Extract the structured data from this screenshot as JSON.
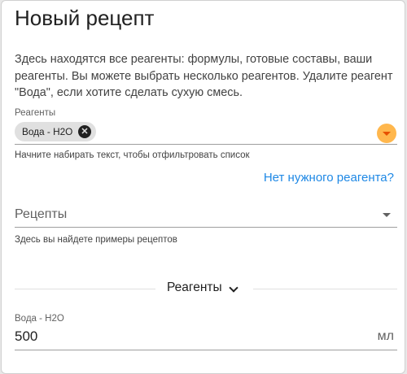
{
  "page": {
    "title": "Новый рецепт",
    "description": "Здесь находятся все реагенты: формулы, готовые составы, ваши реагенты. Вы можете выбрать несколько реагентов. Удалите реагент \"Вода\", если хотите сделать сухую смесь."
  },
  "reagents_field": {
    "label": "Реагенты",
    "chips": [
      {
        "label": "Вода - H2O"
      }
    ],
    "helper": "Начните набирать текст, чтобы отфильтровать список",
    "dropdown_icon": "arrow-drop-down-icon",
    "accent_color": "#ffb74d"
  },
  "missing_link": "Нет нужного реагента?",
  "recipes_field": {
    "placeholder": "Рецепты",
    "helper": "Здесь вы найдете примеры рецептов"
  },
  "reagents_section": {
    "title": "Реагенты",
    "items": [
      {
        "label": "Вода - H2O",
        "value": "500",
        "unit": "мл"
      }
    ]
  },
  "colors": {
    "link": "#1e88e5",
    "chip_bg": "#e0e0e0"
  }
}
